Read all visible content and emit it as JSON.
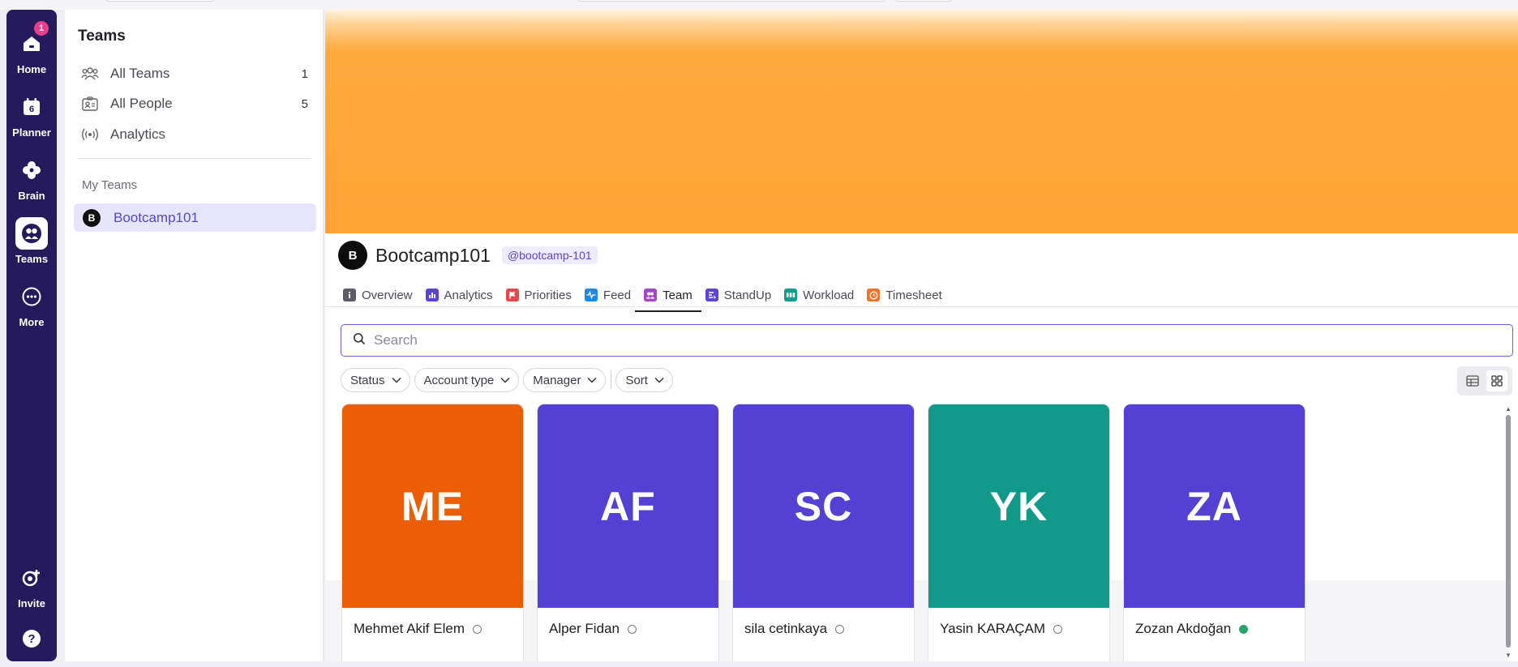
{
  "rail": {
    "items": [
      {
        "label": "Home",
        "badge": "1"
      },
      {
        "label": "Planner",
        "icon_text": "6"
      },
      {
        "label": "Brain"
      },
      {
        "label": "Teams"
      },
      {
        "label": "More"
      },
      {
        "label": "Invite"
      }
    ]
  },
  "sidebar": {
    "title": "Teams",
    "items": [
      {
        "label": "All Teams",
        "count": "1"
      },
      {
        "label": "All People",
        "count": "5"
      },
      {
        "label": "Analytics"
      }
    ],
    "section_label": "My Teams",
    "team": {
      "avatar": "B",
      "name": "Bootcamp101"
    }
  },
  "team": {
    "avatar": "B",
    "name": "Bootcamp101",
    "handle": "@bootcamp-101"
  },
  "tabs": [
    {
      "label": "Overview",
      "color": "#5c5c66"
    },
    {
      "label": "Analytics",
      "color": "#5a44d6"
    },
    {
      "label": "Priorities",
      "color": "#e5484d"
    },
    {
      "label": "Feed",
      "color": "#1e88e5"
    },
    {
      "label": "Team",
      "color": "#a346c9"
    },
    {
      "label": "StandUp",
      "color": "#5a44d6"
    },
    {
      "label": "Workload",
      "color": "#12a08a"
    },
    {
      "label": "Timesheet",
      "color": "#f0722a"
    }
  ],
  "search": {
    "placeholder": "Search",
    "value": ""
  },
  "filters": [
    "Status",
    "Account type",
    "Manager",
    "Sort"
  ],
  "members": [
    {
      "initials": "ME",
      "name": "Mehmet Akif Elem",
      "color": "#ec5e04",
      "online": false
    },
    {
      "initials": "AF",
      "name": "Alper Fidan",
      "color": "#5440d2",
      "online": false
    },
    {
      "initials": "SC",
      "name": "sila cetinkaya",
      "color": "#5440d2",
      "online": false
    },
    {
      "initials": "YK",
      "name": "Yasin KARAÇAM",
      "color": "#11998a",
      "online": false
    },
    {
      "initials": "ZA",
      "name": "Zozan Akdoğan",
      "color": "#5440d2",
      "online": true
    }
  ],
  "colors": {
    "rail": "#241a5c",
    "accent": "#5a44d6",
    "banner": "#ffa334"
  }
}
